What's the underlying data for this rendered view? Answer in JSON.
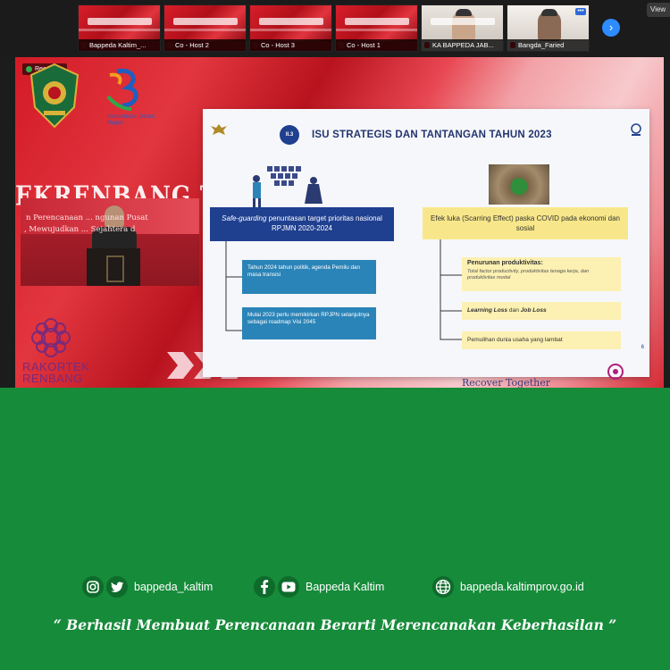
{
  "participants": [
    {
      "name": "Bappeda Kaltim_...",
      "variant": "banner"
    },
    {
      "name": "Co - Host 2",
      "variant": "banner"
    },
    {
      "name": "Co - Host 3",
      "variant": "banner"
    },
    {
      "name": "Co - Host 1",
      "variant": "banner"
    },
    {
      "name": "KA BAPPEDA JAB...",
      "variant": "face"
    },
    {
      "name": "Bangda_Faried",
      "variant": "face-white"
    }
  ],
  "toolbar": {
    "next_icon": "chevron-right-icon",
    "view_label": "View"
  },
  "recording_label": "Recording",
  "event_caption": "Kementerian Dalam Negeri",
  "background_banner": {
    "title": "EKRENBANG TAH",
    "line1": "n Perencanaan ... ngunan Pusat",
    "line2": ", Mewujudkan ... Sejahtera d"
  },
  "rakortek_label": [
    "RAKORTEK",
    "RENBANG"
  ],
  "slide": {
    "badge": "II.3",
    "title": "ISU STRATEGIS DAN TANTANGAN TAHUN 2023",
    "left_main_em": "Safe-guarding",
    "left_main_rest": " penuntasan target prioritas nasional RPJMN 2020-2024",
    "left_items": [
      "Tahun 2024 tahun politik, agenda Pemilu dan masa transisi",
      "Mulai 2023 perlu memikirkan RPJPN selanjutnya sebagai roadmap Visi 2045"
    ],
    "right_main": "Efek luka (Scarring Effect) paska COVID pada ekonomi dan sosial",
    "right_items": {
      "item1_head": "Penurunan produktivitas:",
      "item1_detail": "Total factor productivity, produktivitas tenaga kerja, dan produktivitas modal",
      "item2_a": "Learning Loss",
      "item2_mid": " dan ",
      "item2_b": "Job Loss",
      "item3": "Pemulihan dunia usaha yang lambat"
    },
    "page_number": "6"
  },
  "recover_text": "Recover Together",
  "footer": {
    "handle_social": "bappeda_kaltim",
    "handle_media": "Bappeda Kaltim",
    "website": "bappeda.kaltimprov.go.id",
    "tagline": "“ Berhasil  Membuat Perencanaan Berarti Merencanakan Keberhasilan ”"
  },
  "colors": {
    "footer_green": "#168b3a",
    "slide_navy": "#1f3f8f",
    "slide_yellow": "#f8e78a",
    "banner_red": "#d31b27"
  }
}
